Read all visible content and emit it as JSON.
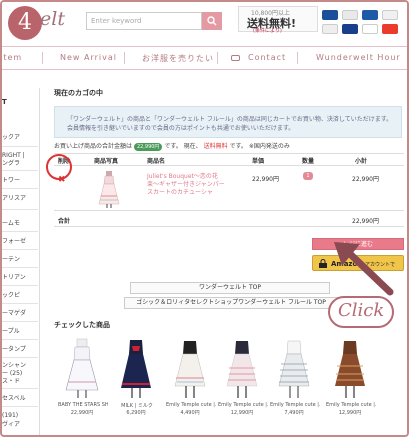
{
  "step": "4",
  "header": {
    "logo_text": "elt",
    "search_placeholder": "Enter keyword",
    "promo_top": "10,800円以上",
    "promo_main": "送料無料!",
    "promo_note": "(条件により)"
  },
  "nav": {
    "items": [
      "Item",
      "New Arrival",
      "お洋服を売りたい",
      "Contact",
      "Wunderwelt Hour"
    ]
  },
  "sidebar": {
    "heading": "T",
    "items": [
      "ックア",
      "RIGHT |",
      "ングラ",
      "トワー",
      "アリスア",
      "ームモ",
      "フォーゼ",
      "ーテン",
      "トリアン",
      "ックピ",
      "ーマゲダ",
      "ープル",
      "ータンプ",
      "ンシャン",
      "ー (25)",
      "ス・ド",
      "セスベル",
      "(191)",
      "ヴィア"
    ]
  },
  "cart": {
    "title": "現在のカゴの中",
    "notice_line1": "「ワンダーウェルト」の商品と「ワンダーウェルト フルール」の商品は同じカートでお買い物、決済していただけます。",
    "notice_line2": "会員情報を引き継いでいますので会員の方はポイントも共通でお使いいただけます。",
    "total_prefix": "お買い上げ商品の合計金額は",
    "total_badge": "22,990円",
    "total_mid": "です。 現在、",
    "total_red": "送料無料",
    "total_suffix": "です。 ※国内発送のみ",
    "headers": {
      "delete": "削除",
      "photo": "商品写真",
      "name": "商品名",
      "price": "単価",
      "qty": "数量",
      "subtotal": "小計"
    },
    "row": {
      "delete_mark": "✖",
      "name": "Juliet's Bouquet〜恋の花束〜ギャザー付きジャンパースカートのカチューシャ",
      "price": "22,990円",
      "qty": "1",
      "subtotal": "22,990円"
    },
    "sum_label": "合計",
    "sum_value": "22,990円",
    "checkout_label": "レジに進む",
    "amazon_label": "Amazon",
    "amazon_suffix": "アカウントで"
  },
  "links": {
    "top": "ワンダーウェルト TOP",
    "fleur_top": "ゴシック＆ロリィタセレクトショップワンダーウェルト フルール TOP"
  },
  "checked": {
    "title": "チェックした商品",
    "items": [
      {
        "name": "BABY THE STARS SHI...",
        "price": "22,990円"
      },
      {
        "name": "MILK | ミルク",
        "price": "6,290円"
      },
      {
        "name": "Emily Temple cute |...",
        "price": "4,490円"
      },
      {
        "name": "Emily Temple cute |...",
        "price": "12,990円"
      },
      {
        "name": "Emily Temple cute |...",
        "price": "7,490円"
      },
      {
        "name": "Emily Temple cute |...",
        "price": "12,990円"
      }
    ]
  },
  "overlay": {
    "click_text": "Click"
  },
  "colors": {
    "accent_pink": "#e87a8a",
    "frame": "#c48a8a",
    "delete_red": "#dd3333"
  }
}
